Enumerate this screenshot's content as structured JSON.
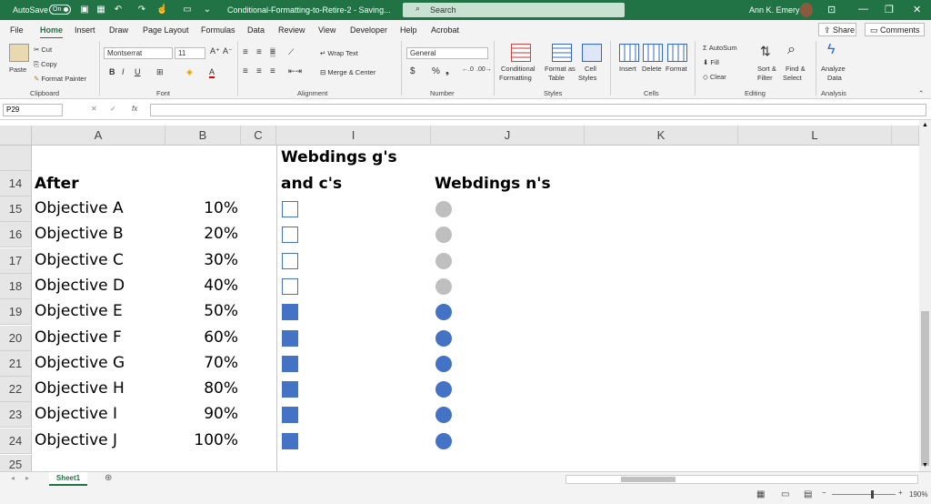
{
  "titlebar": {
    "autosave_label": "AutoSave",
    "autosave_state": "On",
    "doc_title": "Conditional-Formatting-to-Retire-2  -  Saving...",
    "search_placeholder": "Search",
    "user_name": "Ann K. Emery"
  },
  "menu": [
    "File",
    "Home",
    "Insert",
    "Draw",
    "Page Layout",
    "Formulas",
    "Data",
    "Review",
    "View",
    "Developer",
    "Help",
    "Acrobat"
  ],
  "menu_active": "Home",
  "share_label": "Share",
  "comments_label": "Comments",
  "ribbon": {
    "clipboard": {
      "paste": "Paste",
      "cut": "Cut",
      "copy": "Copy",
      "format_painter": "Format Painter",
      "group": "Clipboard"
    },
    "font": {
      "name": "Montserrat",
      "size": "11",
      "group": "Font"
    },
    "alignment": {
      "wrap": "Wrap Text",
      "merge": "Merge & Center",
      "group": "Alignment"
    },
    "number": {
      "format": "General",
      "group": "Number"
    },
    "styles": {
      "cond1": "Conditional",
      "cond2": "Formatting",
      "fmt1": "Format as",
      "fmt2": "Table",
      "cell1": "Cell",
      "cell2": "Styles",
      "group": "Styles"
    },
    "cells": {
      "insert": "Insert",
      "delete": "Delete",
      "format": "Format",
      "group": "Cells"
    },
    "editing": {
      "autosum": "AutoSum",
      "fill": "Fill",
      "clear": "Clear",
      "sort1": "Sort &",
      "sort2": "Filter",
      "find1": "Find &",
      "find2": "Select",
      "group": "Editing"
    },
    "analysis": {
      "analyze1": "Analyze",
      "analyze2": "Data",
      "group": "Analysis"
    }
  },
  "namebox": "P29",
  "fx": "fx",
  "columns": [
    "A",
    "B",
    "C",
    "I",
    "J",
    "K",
    "L"
  ],
  "header_rows": {
    "i_line1": "Webdings g's",
    "i_line2": "and c's",
    "j": "Webdings n's",
    "a14": "After",
    "row13": "",
    "row14": "14"
  },
  "rows": [
    {
      "num": "15",
      "label": "Objective A",
      "pct": "10%",
      "checked": false
    },
    {
      "num": "16",
      "label": "Objective B",
      "pct": "20%",
      "checked": false
    },
    {
      "num": "17",
      "label": "Objective C",
      "pct": "30%",
      "checked": false
    },
    {
      "num": "18",
      "label": "Objective D",
      "pct": "40%",
      "checked": false
    },
    {
      "num": "19",
      "label": "Objective E",
      "pct": "50%",
      "checked": true
    },
    {
      "num": "20",
      "label": "Objective F",
      "pct": "60%",
      "checked": true
    },
    {
      "num": "21",
      "label": "Objective G",
      "pct": "70%",
      "checked": true
    },
    {
      "num": "22",
      "label": "Objective H",
      "pct": "80%",
      "checked": true
    },
    {
      "num": "23",
      "label": "Objective I",
      "pct": "90%",
      "checked": true
    },
    {
      "num": "24",
      "label": "Objective J",
      "pct": "100%",
      "checked": true
    }
  ],
  "last_row": "25",
  "colors": {
    "accent": "#217346",
    "filled": "#4472c4",
    "empty_dot": "#bfbfbf"
  },
  "sheet_tab": "Sheet1",
  "zoom": "190%"
}
